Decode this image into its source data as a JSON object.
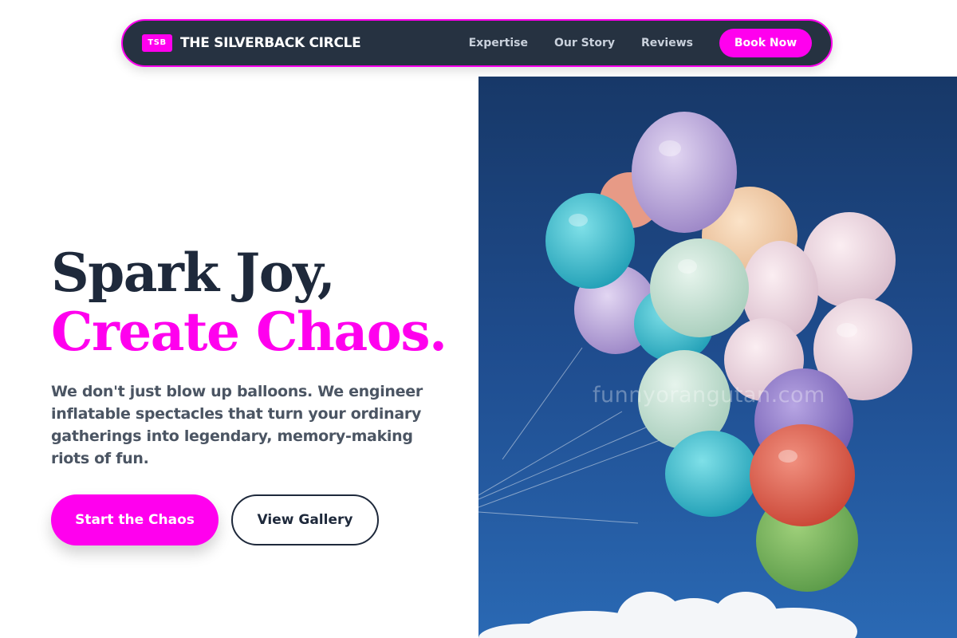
{
  "nav": {
    "badge": "TSB",
    "brand": "THE SILVERBACK CIRCLE",
    "links": [
      "Expertise",
      "Our Story",
      "Reviews"
    ],
    "cta": "Book Now"
  },
  "hero": {
    "title_line1": "Spark Joy,",
    "title_line2": "Create Chaos.",
    "description": "We don't just blow up balloons. We engineer inflatable spectacles that turn your ordinary gatherings into legendary, memory-making riots of fun.",
    "primary_button": "Start the Chaos",
    "secondary_button": "View Gallery"
  },
  "image": {
    "watermark": "funnyorangutan.com"
  },
  "colors": {
    "accent": "#ff00ee",
    "nav_bg": "#263241",
    "heading": "#1e293b",
    "body_text": "#4b5563",
    "sky": "#1f4d8f"
  }
}
